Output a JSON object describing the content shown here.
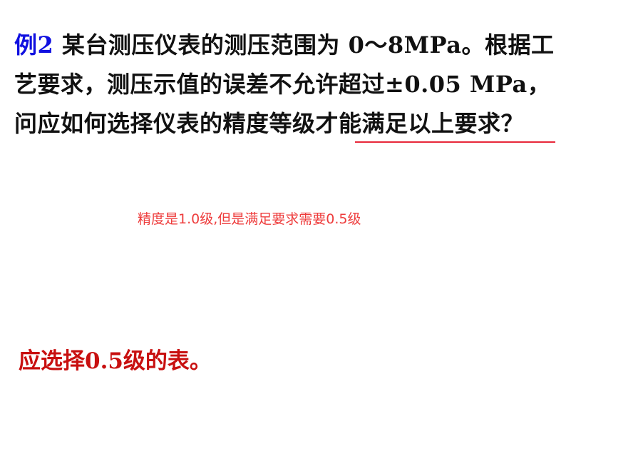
{
  "question": {
    "label": "例2",
    "line1": " 某台测压仪表的测压范围为 0～8MPa。根据工",
    "line2": "艺要求，测压示值的误差不允许超过±0.05 MPa，",
    "line3": "问应如何选择仪表的精度等级才能满足以上要求？"
  },
  "note": "精度是1.0级,但是满足要求需要0.5级",
  "answer": "应选择0.5级的表。",
  "colors": {
    "label": "#1010e0",
    "underline": "#e8283a",
    "note": "#ee3c3c",
    "answer": "#c81010"
  }
}
